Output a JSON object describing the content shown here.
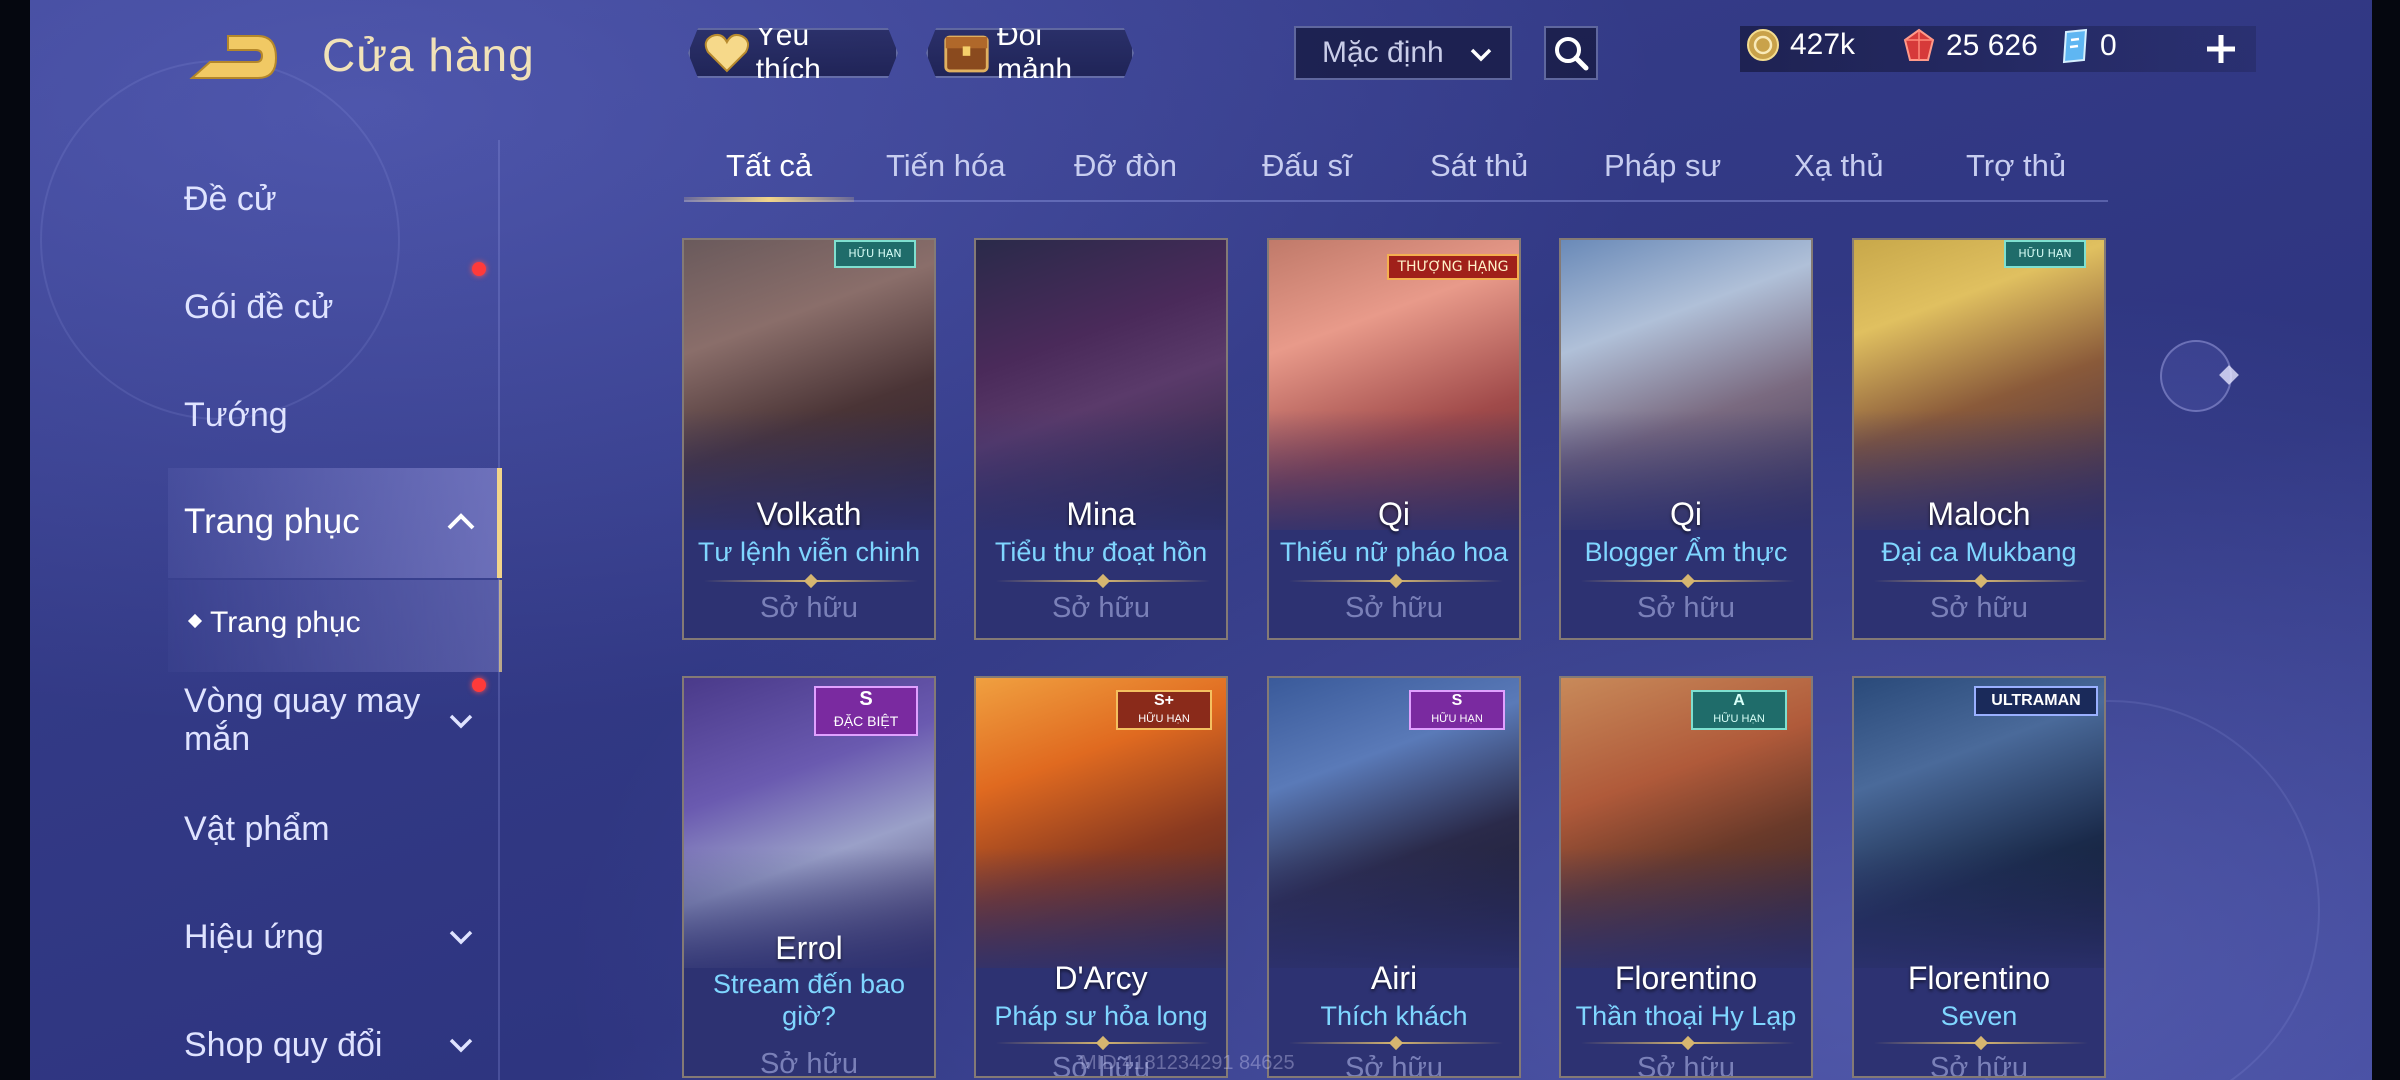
{
  "header": {
    "title": "Cửa hàng",
    "favorites_label": "Yêu thích",
    "exchange_label": "Đổi mảnh",
    "sort_selected": "Mặc định",
    "currencies": [
      {
        "icon": "gold-coin-icon",
        "value": "427k"
      },
      {
        "icon": "ruby-gem-icon",
        "value": "25 626"
      },
      {
        "icon": "voucher-icon",
        "value": "0"
      }
    ]
  },
  "sidebar": {
    "items": [
      {
        "label": "Đề cử"
      },
      {
        "label": "Gói đề cử"
      },
      {
        "label": "Tướng"
      },
      {
        "label": "Trang phục"
      },
      {
        "label": "Trang phục"
      },
      {
        "label": "Vòng quay may mắn"
      },
      {
        "label": "Vật phẩm"
      },
      {
        "label": "Hiệu ứng"
      },
      {
        "label": "Shop quy đổi"
      }
    ]
  },
  "tabs": [
    "Tất cả",
    "Tiến hóa",
    "Đỡ đòn",
    "Đấu sĩ",
    "Sát thủ",
    "Pháp sư",
    "Xạ thủ",
    "Trợ thủ"
  ],
  "cards": [
    {
      "hero": "Volkath",
      "skin": "Tư lệnh viễn chinh",
      "status": "Sở hữu",
      "badge": "HỮU HẠN"
    },
    {
      "hero": "Mina",
      "skin": "Tiểu thư đoạt hồn",
      "status": "Sở hữu",
      "badge": ""
    },
    {
      "hero": "Qi",
      "skin": "Thiếu nữ pháo hoa",
      "status": "Sở hữu",
      "badge": "THƯỢNG HẠNG"
    },
    {
      "hero": "Qi",
      "skin": "Blogger Ẩm thực",
      "status": "Sở hữu",
      "badge": ""
    },
    {
      "hero": "Maloch",
      "skin": "Đại ca Mukbang",
      "status": "Sở hữu",
      "badge": "HỮU HẠN"
    },
    {
      "hero": "Errol",
      "skin": "Stream đến bao giờ?",
      "status": "Sở hữu",
      "badge_tier": "S",
      "badge": "ĐẶC BIỆT"
    },
    {
      "hero": "D'Arcy",
      "skin": "Pháp sư hỏa long",
      "status": "Sở hữu",
      "badge_tier": "S+",
      "badge": "HỮU HẠN"
    },
    {
      "hero": "Airi",
      "skin": "Thích khách",
      "status": "Sở hữu",
      "badge_tier": "S",
      "badge": "HỮU HẠN"
    },
    {
      "hero": "Florentino",
      "skin": "Thần thoại Hy Lạp",
      "status": "Sở hữu",
      "badge_tier": "A",
      "badge": "HỮU HẠN"
    },
    {
      "hero": "Florentino",
      "skin": "Seven",
      "status": "Sở hữu",
      "badge": "ULTRAMAN"
    }
  ],
  "watermark": "MID:4181234291 84625",
  "colors": {
    "accent": "#f2d58a",
    "skin_name": "#7fd6ff",
    "alert": "#ff3a3a"
  }
}
